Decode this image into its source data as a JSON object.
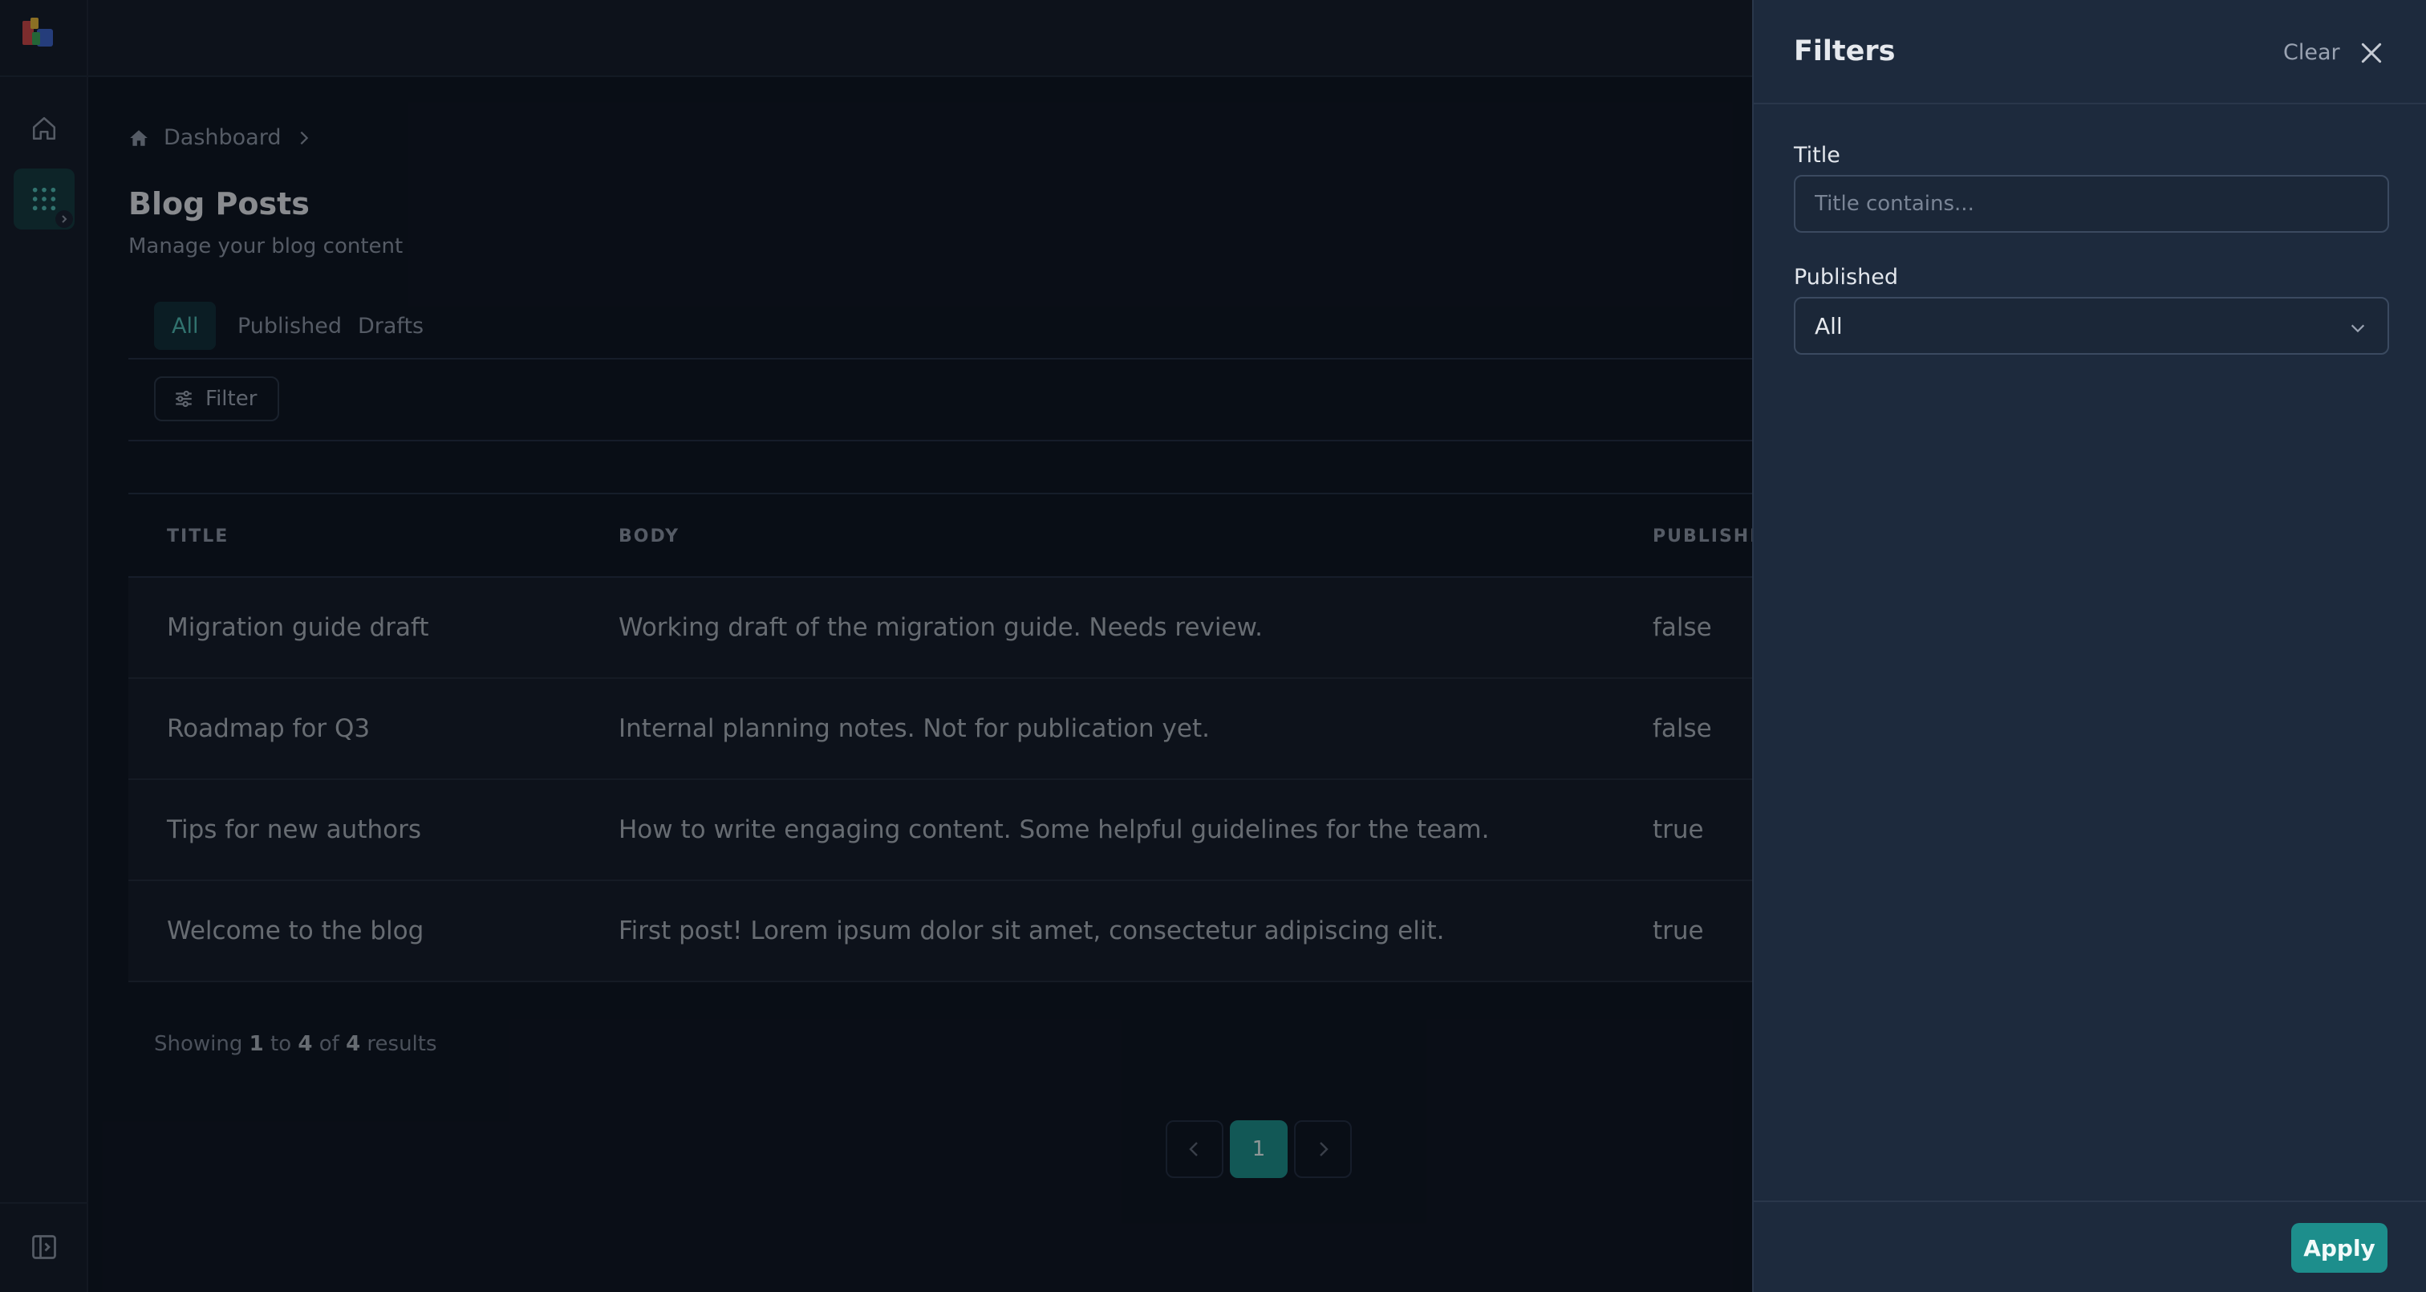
{
  "sidebar": {
    "logo_icon": "app-logo",
    "items": [
      {
        "icon": "home-icon",
        "active": false
      },
      {
        "icon": "grid-icon",
        "active": true
      }
    ],
    "bottom_icon": "sidebar-toggle-icon"
  },
  "breadcrumb": {
    "items": [
      "Dashboard"
    ]
  },
  "page": {
    "title": "Blog Posts",
    "subtitle": "Manage your blog content"
  },
  "tabs": [
    "All",
    "Published",
    "Drafts"
  ],
  "toolbar": {
    "filter_label": "Filter"
  },
  "table": {
    "columns": [
      "TITLE",
      "BODY",
      "PUBLISHE"
    ],
    "rows": [
      {
        "title": "Migration guide draft",
        "body": "Working draft of the migration guide. Needs review.",
        "published": "false"
      },
      {
        "title": "Roadmap for Q3",
        "body": "Internal planning notes. Not for publication yet.",
        "published": "false"
      },
      {
        "title": "Tips for new authors",
        "body": "How to write engaging content. Some helpful guidelines for the team.",
        "published": "true"
      },
      {
        "title": "Welcome to the blog",
        "body": "First post! Lorem ipsum dolor sit amet, consectetur adipiscing elit.",
        "published": "true"
      }
    ]
  },
  "results": {
    "prefix": "Showing",
    "from": "1",
    "to_word": "to",
    "to": "4",
    "of_word": "of",
    "total": "4",
    "suffix": "results"
  },
  "pagination": {
    "current": "1"
  },
  "drawer": {
    "title": "Filters",
    "clear_label": "Clear",
    "fields": {
      "title_label": "Title",
      "title_value": "",
      "title_placeholder": "Title contains...",
      "published_label": "Published",
      "published_value": "All"
    },
    "apply_label": "Apply"
  },
  "colors": {
    "accent": "#1d8e8c",
    "background": "#101725",
    "drawer": "#1d2a3d"
  }
}
